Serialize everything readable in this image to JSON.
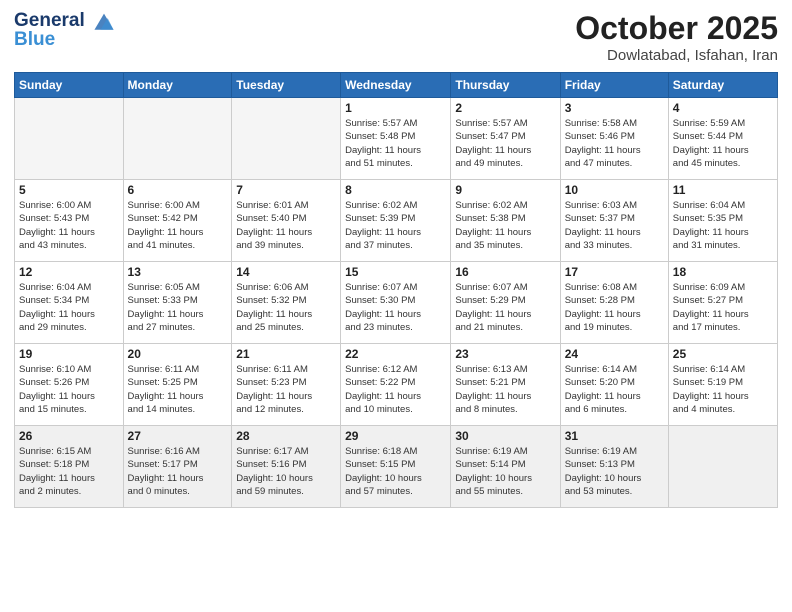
{
  "header": {
    "logo_line1": "General",
    "logo_line2": "Blue",
    "month_title": "October 2025",
    "location": "Dowlatabad, Isfahan, Iran"
  },
  "weekdays": [
    "Sunday",
    "Monday",
    "Tuesday",
    "Wednesday",
    "Thursday",
    "Friday",
    "Saturday"
  ],
  "weeks": [
    [
      {
        "day": "",
        "info": ""
      },
      {
        "day": "",
        "info": ""
      },
      {
        "day": "",
        "info": ""
      },
      {
        "day": "1",
        "info": "Sunrise: 5:57 AM\nSunset: 5:48 PM\nDaylight: 11 hours\nand 51 minutes."
      },
      {
        "day": "2",
        "info": "Sunrise: 5:57 AM\nSunset: 5:47 PM\nDaylight: 11 hours\nand 49 minutes."
      },
      {
        "day": "3",
        "info": "Sunrise: 5:58 AM\nSunset: 5:46 PM\nDaylight: 11 hours\nand 47 minutes."
      },
      {
        "day": "4",
        "info": "Sunrise: 5:59 AM\nSunset: 5:44 PM\nDaylight: 11 hours\nand 45 minutes."
      }
    ],
    [
      {
        "day": "5",
        "info": "Sunrise: 6:00 AM\nSunset: 5:43 PM\nDaylight: 11 hours\nand 43 minutes."
      },
      {
        "day": "6",
        "info": "Sunrise: 6:00 AM\nSunset: 5:42 PM\nDaylight: 11 hours\nand 41 minutes."
      },
      {
        "day": "7",
        "info": "Sunrise: 6:01 AM\nSunset: 5:40 PM\nDaylight: 11 hours\nand 39 minutes."
      },
      {
        "day": "8",
        "info": "Sunrise: 6:02 AM\nSunset: 5:39 PM\nDaylight: 11 hours\nand 37 minutes."
      },
      {
        "day": "9",
        "info": "Sunrise: 6:02 AM\nSunset: 5:38 PM\nDaylight: 11 hours\nand 35 minutes."
      },
      {
        "day": "10",
        "info": "Sunrise: 6:03 AM\nSunset: 5:37 PM\nDaylight: 11 hours\nand 33 minutes."
      },
      {
        "day": "11",
        "info": "Sunrise: 6:04 AM\nSunset: 5:35 PM\nDaylight: 11 hours\nand 31 minutes."
      }
    ],
    [
      {
        "day": "12",
        "info": "Sunrise: 6:04 AM\nSunset: 5:34 PM\nDaylight: 11 hours\nand 29 minutes."
      },
      {
        "day": "13",
        "info": "Sunrise: 6:05 AM\nSunset: 5:33 PM\nDaylight: 11 hours\nand 27 minutes."
      },
      {
        "day": "14",
        "info": "Sunrise: 6:06 AM\nSunset: 5:32 PM\nDaylight: 11 hours\nand 25 minutes."
      },
      {
        "day": "15",
        "info": "Sunrise: 6:07 AM\nSunset: 5:30 PM\nDaylight: 11 hours\nand 23 minutes."
      },
      {
        "day": "16",
        "info": "Sunrise: 6:07 AM\nSunset: 5:29 PM\nDaylight: 11 hours\nand 21 minutes."
      },
      {
        "day": "17",
        "info": "Sunrise: 6:08 AM\nSunset: 5:28 PM\nDaylight: 11 hours\nand 19 minutes."
      },
      {
        "day": "18",
        "info": "Sunrise: 6:09 AM\nSunset: 5:27 PM\nDaylight: 11 hours\nand 17 minutes."
      }
    ],
    [
      {
        "day": "19",
        "info": "Sunrise: 6:10 AM\nSunset: 5:26 PM\nDaylight: 11 hours\nand 15 minutes."
      },
      {
        "day": "20",
        "info": "Sunrise: 6:11 AM\nSunset: 5:25 PM\nDaylight: 11 hours\nand 14 minutes."
      },
      {
        "day": "21",
        "info": "Sunrise: 6:11 AM\nSunset: 5:23 PM\nDaylight: 11 hours\nand 12 minutes."
      },
      {
        "day": "22",
        "info": "Sunrise: 6:12 AM\nSunset: 5:22 PM\nDaylight: 11 hours\nand 10 minutes."
      },
      {
        "day": "23",
        "info": "Sunrise: 6:13 AM\nSunset: 5:21 PM\nDaylight: 11 hours\nand 8 minutes."
      },
      {
        "day": "24",
        "info": "Sunrise: 6:14 AM\nSunset: 5:20 PM\nDaylight: 11 hours\nand 6 minutes."
      },
      {
        "day": "25",
        "info": "Sunrise: 6:14 AM\nSunset: 5:19 PM\nDaylight: 11 hours\nand 4 minutes."
      }
    ],
    [
      {
        "day": "26",
        "info": "Sunrise: 6:15 AM\nSunset: 5:18 PM\nDaylight: 11 hours\nand 2 minutes."
      },
      {
        "day": "27",
        "info": "Sunrise: 6:16 AM\nSunset: 5:17 PM\nDaylight: 11 hours\nand 0 minutes."
      },
      {
        "day": "28",
        "info": "Sunrise: 6:17 AM\nSunset: 5:16 PM\nDaylight: 10 hours\nand 59 minutes."
      },
      {
        "day": "29",
        "info": "Sunrise: 6:18 AM\nSunset: 5:15 PM\nDaylight: 10 hours\nand 57 minutes."
      },
      {
        "day": "30",
        "info": "Sunrise: 6:19 AM\nSunset: 5:14 PM\nDaylight: 10 hours\nand 55 minutes."
      },
      {
        "day": "31",
        "info": "Sunrise: 6:19 AM\nSunset: 5:13 PM\nDaylight: 10 hours\nand 53 minutes."
      },
      {
        "day": "",
        "info": ""
      }
    ]
  ]
}
